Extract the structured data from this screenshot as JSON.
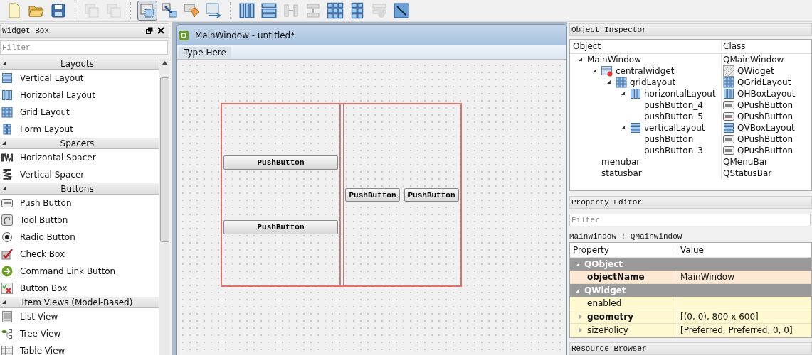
{
  "toolbar": [
    [
      {
        "selected": false,
        "disabled": false
      },
      {
        "selected": false,
        "disabled": false
      },
      {
        "selected": false,
        "disabled": false
      }
    ],
    [
      {
        "selected": false,
        "disabled": true
      },
      {
        "selected": false,
        "disabled": true
      }
    ],
    [
      {
        "selected": true,
        "disabled": false
      },
      {
        "selected": false,
        "disabled": false
      },
      {
        "selected": false,
        "disabled": false
      },
      {
        "selected": false,
        "disabled": false
      }
    ],
    [
      {
        "selected": false,
        "disabled": false
      },
      {
        "selected": false,
        "disabled": false
      },
      {
        "selected": false,
        "disabled": true
      },
      {
        "selected": false,
        "disabled": true
      },
      {
        "selected": false,
        "disabled": false
      },
      {
        "selected": false,
        "disabled": false
      },
      {
        "selected": false,
        "disabled": true
      },
      {
        "selected": false,
        "disabled": false
      }
    ]
  ],
  "widget_box": {
    "title": "Widget Box",
    "filter_placeholder": "Filter",
    "sections": [
      {
        "title": "Layouts",
        "expanded": true,
        "items": [
          "Vertical Layout",
          "Horizontal Layout",
          "Grid Layout",
          "Form Layout"
        ]
      },
      {
        "title": "Spacers",
        "expanded": true,
        "items": [
          "Horizontal Spacer",
          "Vertical Spacer"
        ]
      },
      {
        "title": "Buttons",
        "expanded": true,
        "items": [
          "Push Button",
          "Tool Button",
          "Radio Button",
          "Check Box",
          "Command Link Button",
          "Button Box"
        ]
      },
      {
        "title": "Item Views (Model-Based)",
        "expanded": true,
        "items": [
          "List View",
          "Tree View",
          "Table View"
        ]
      }
    ]
  },
  "form_window": {
    "title": "MainWindow - untitled*",
    "menu_placeholder": "Type Here",
    "vertical_layout": {
      "buttons": [
        "PushButton",
        "PushButton"
      ]
    },
    "horizontal_layout": {
      "buttons": [
        "PushButton",
        "PushButton"
      ]
    }
  },
  "object_inspector": {
    "title": "Object Inspector",
    "columns": [
      "Object",
      "Class"
    ],
    "tree": [
      {
        "object": "MainWindow",
        "class": "QMainWindow",
        "expanded": true,
        "children": [
          {
            "object": "centralwidget",
            "class": "QWidget",
            "expanded": true,
            "children": [
              {
                "object": "gridLayout",
                "class": "QGridLayout",
                "expanded": true,
                "children": [
                  {
                    "object": "horizontalLayout",
                    "class": "QHBoxLayout",
                    "expanded": true,
                    "children": [
                      {
                        "object": "pushButton_4",
                        "class": "QPushButton"
                      },
                      {
                        "object": "pushButton_5",
                        "class": "QPushButton"
                      }
                    ]
                  },
                  {
                    "object": "verticalLayout",
                    "class": "QVBoxLayout",
                    "expanded": true,
                    "children": [
                      {
                        "object": "pushButton",
                        "class": "QPushButton"
                      },
                      {
                        "object": "pushButton_3",
                        "class": "QPushButton"
                      }
                    ]
                  }
                ]
              }
            ]
          },
          {
            "object": "menubar",
            "class": "QMenuBar"
          },
          {
            "object": "statusbar",
            "class": "QStatusBar"
          }
        ]
      }
    ]
  },
  "property_editor": {
    "title": "Property Editor",
    "filter_placeholder": "Filter",
    "object_label": "MainWindow : QMainWindow",
    "columns": [
      "Property",
      "Value"
    ],
    "groups": [
      {
        "name": "QObject",
        "expanded": true,
        "properties": [
          {
            "name": "objectName",
            "value": "MainWindow",
            "changed": true
          }
        ]
      },
      {
        "name": "QWidget",
        "expanded": true,
        "properties": [
          {
            "name": "enabled",
            "changed": false
          },
          {
            "name": "geometry",
            "value": "[(0, 0), 800 x 600]",
            "changed": true,
            "expanded": false
          },
          {
            "name": "sizePolicy",
            "value": "[Preferred, Preferred, 0, 0]",
            "changed": false,
            "expanded": false
          }
        ]
      }
    ]
  },
  "resource_browser": {
    "title": "Resource Browser"
  }
}
